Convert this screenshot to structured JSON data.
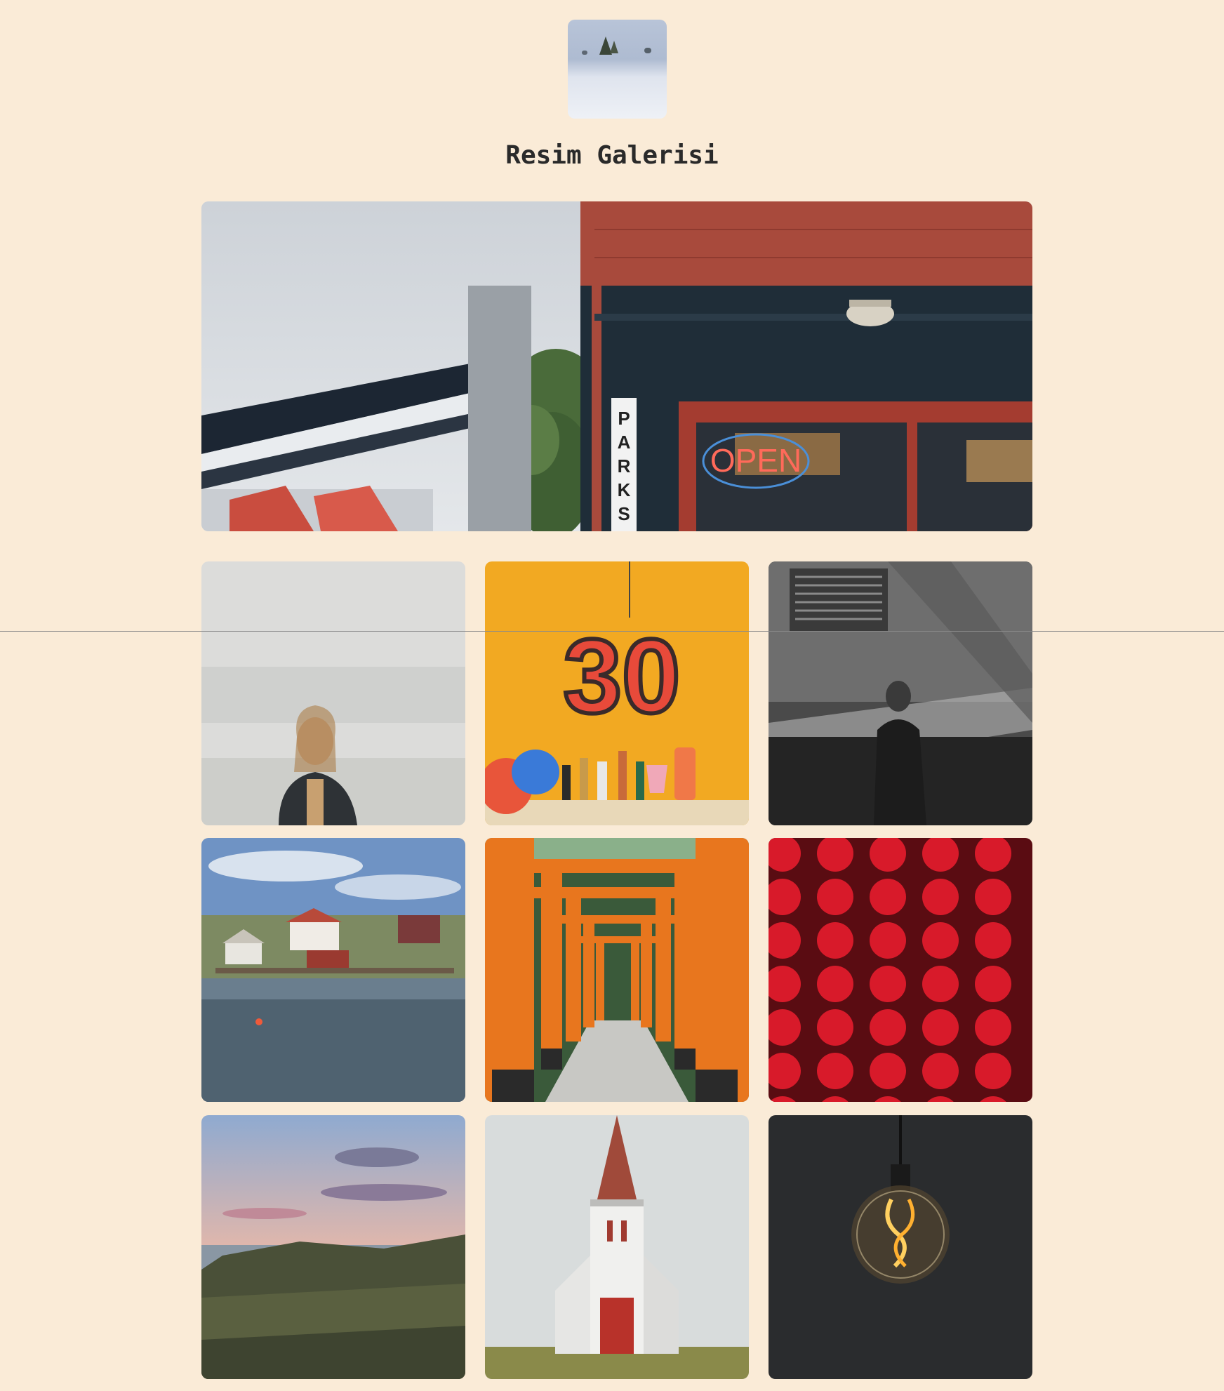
{
  "page": {
    "title": "Resim Galerisi",
    "background_color": "#faebd7"
  },
  "logo": {
    "icon": "snowy-landscape-thumbnail"
  },
  "hero": {
    "icon": "storefront-photo",
    "sign_open": "OPEN",
    "sign_park": "PARK S"
  },
  "gallery": [
    {
      "icon": "woman-portrait-fog-photo"
    },
    {
      "icon": "number-30-pinata-photo",
      "text": "30"
    },
    {
      "icon": "woman-shadows-bw-photo"
    },
    {
      "icon": "lake-village-photo"
    },
    {
      "icon": "torii-gates-photo"
    },
    {
      "icon": "red-lanterns-photo"
    },
    {
      "icon": "coast-sunset-photo"
    },
    {
      "icon": "white-chapel-photo"
    },
    {
      "icon": "light-bulb-photo"
    }
  ]
}
